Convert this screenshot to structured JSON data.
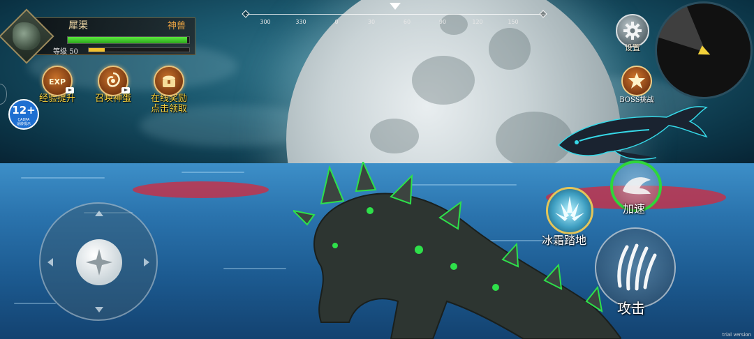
{
  "player": {
    "name": "犀渠",
    "title": "神兽",
    "level_label": "等级",
    "level": "50",
    "hp_fraction": 0.98,
    "exp_fraction": 0.16
  },
  "features": [
    {
      "label": "经验提升",
      "icon": "exp-boost-icon",
      "badge": "video"
    },
    {
      "label": "召唤神蛋",
      "icon": "dragon-egg-icon",
      "badge": "video"
    },
    {
      "label": "在线奖励",
      "label2": "点击领取",
      "icon": "treasure-chest-icon"
    }
  ],
  "age_rating": {
    "number": "12+",
    "org": "CADPA",
    "sub": "适龄提示"
  },
  "compass": {
    "ticks": [
      "300",
      "330",
      "0",
      "30",
      "60",
      "90",
      "120",
      "150"
    ]
  },
  "settings": {
    "label": "设置",
    "icon": "gear-icon"
  },
  "boss": {
    "label": "BOSS挑战",
    "icon": "boss-challenge-icon"
  },
  "skills": {
    "speed": {
      "label": "加速",
      "icon": "speed-dash-icon"
    },
    "frost": {
      "label": "冰霜踏地",
      "icon": "frost-stomp-icon"
    },
    "attack": {
      "label": "攻击",
      "icon": "claw-attack-icon"
    }
  },
  "watermark": "trial version",
  "colors": {
    "hp": "#3fcf2b",
    "exp": "#f2c12e",
    "label_gold": "#f7d23e",
    "red_zone": "#d6283c"
  }
}
